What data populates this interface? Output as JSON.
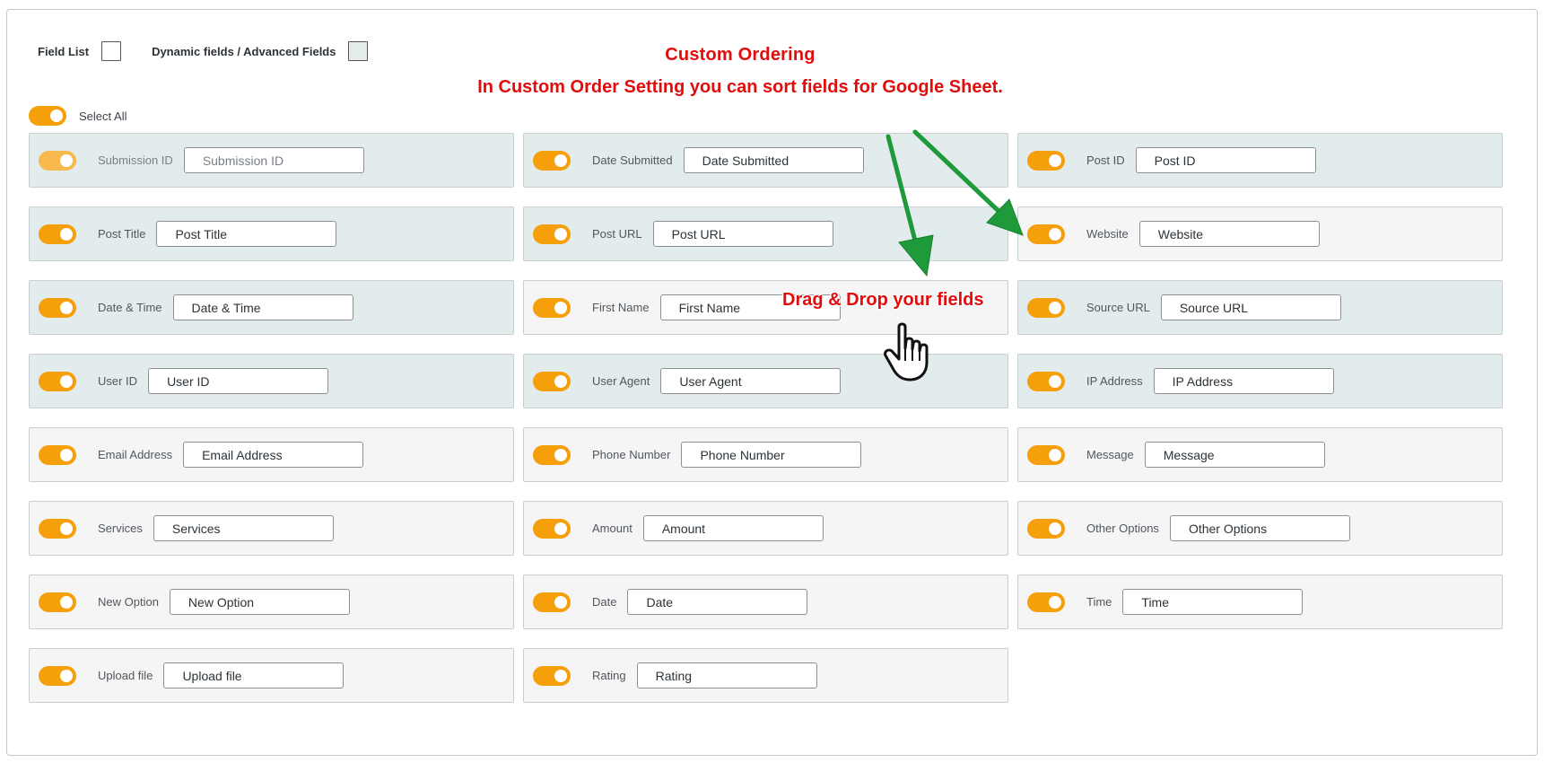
{
  "header": {
    "field_list_label": "Field List",
    "dynamic_fields_label": "Dynamic fields / Advanced Fields"
  },
  "select_all_label": "Select All",
  "annotations": {
    "title": "Custom Ordering",
    "subtitle": "In Custom Order Setting you can sort fields for Google Sheet.",
    "drag_hint": "Drag & Drop your fields"
  },
  "fields": [
    {
      "label": "Submission ID",
      "value": "Submission ID"
    },
    {
      "label": "Date Submitted",
      "value": "Date Submitted"
    },
    {
      "label": "Post ID",
      "value": "Post ID"
    },
    {
      "label": "Post Title",
      "value": "Post Title"
    },
    {
      "label": "Post URL",
      "value": "Post URL"
    },
    {
      "label": "Website",
      "value": "Website"
    },
    {
      "label": "Date & Time",
      "value": "Date & Time"
    },
    {
      "label": "First Name",
      "value": "First Name"
    },
    {
      "label": "Source URL",
      "value": "Source URL"
    },
    {
      "label": "User ID",
      "value": "User ID"
    },
    {
      "label": "User Agent",
      "value": "User Agent"
    },
    {
      "label": "IP Address",
      "value": "IP Address"
    },
    {
      "label": "Email Address",
      "value": "Email Address"
    },
    {
      "label": "Phone Number",
      "value": "Phone Number"
    },
    {
      "label": "Message",
      "value": "Message"
    },
    {
      "label": "Services",
      "value": "Services"
    },
    {
      "label": "Amount",
      "value": "Amount"
    },
    {
      "label": "Other Options",
      "value": "Other Options"
    },
    {
      "label": "New Option",
      "value": "New Option"
    },
    {
      "label": "Date",
      "value": "Date"
    },
    {
      "label": "Time",
      "value": "Time"
    },
    {
      "label": "Upload file",
      "value": "Upload file"
    },
    {
      "label": "Rating",
      "value": "Rating"
    }
  ],
  "colors": {
    "toggle_on": "#f59f0b",
    "annotation_text": "#e10d0d",
    "arrow": "#1f9a3a",
    "card_teal": "#e2ecec",
    "card_plain": "#f5f5f5"
  }
}
